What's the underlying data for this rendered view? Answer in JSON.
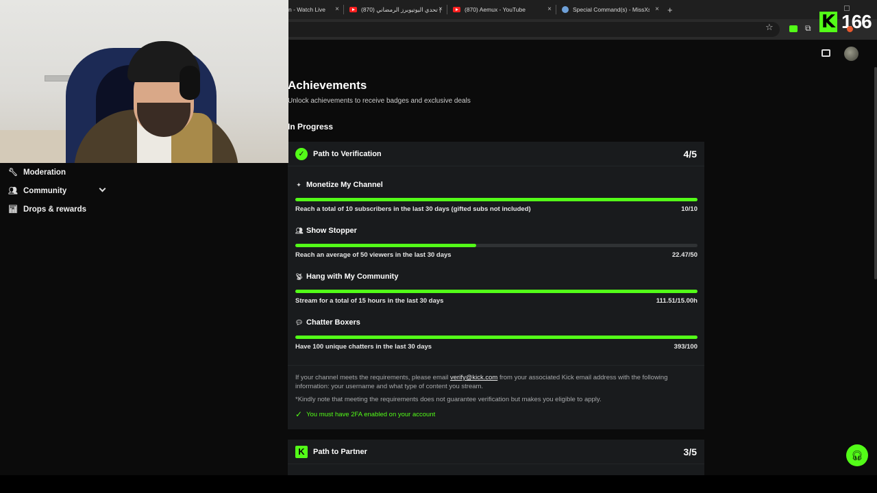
{
  "browser": {
    "tabs": [
      {
        "title": "n - Watch Live",
        "icon": "none"
      },
      {
        "title": "(870) تحدي اليوتيوبرز الرمضاني |",
        "icon": "youtube-icon"
      },
      {
        "title": "(870) Aemux - YouTube",
        "icon": "youtube-icon"
      },
      {
        "title": "Special Command(s) - MissXss",
        "icon": "globe-icon"
      }
    ],
    "close_glyph": "×",
    "new_tab_glyph": "+"
  },
  "kick_counter": {
    "logo": "K",
    "value": "166"
  },
  "sidebar": {
    "items": [
      {
        "label": "Moderation",
        "icon": "wrench-icon"
      },
      {
        "label": "Community",
        "icon": "users-icon"
      },
      {
        "label": "Drops & rewards",
        "icon": "gift-chart-icon"
      }
    ]
  },
  "main": {
    "title": "Achievements",
    "subtitle": "Unlock achievements to receive badges and exclusive deals",
    "section_title": "In Progress",
    "verification": {
      "title": "Path to Verification",
      "score": "4/5",
      "tasks": [
        {
          "title": "Monetize My Channel",
          "icon": "sparkle-icon",
          "desc": "Reach a total of 10 subscribers in the last 30 days (gifted subs not included)",
          "value": "10/10",
          "progress": 1.0
        },
        {
          "title": "Show Stopper",
          "icon": "users-icon",
          "desc": "Reach an average of 50 viewers in the last 30 days",
          "value": "22.47/50",
          "progress": 0.449
        },
        {
          "title": "Hang with My Community",
          "icon": "broadcast-icon",
          "desc": "Stream for a total of 15 hours in the last 30 days",
          "value": "111.51/15.00h",
          "progress": 1.0
        },
        {
          "title": "Chatter Boxers",
          "icon": "chat-icon",
          "desc": "Have 100 unique chatters in the last 30 days",
          "value": "393/100",
          "progress": 1.0
        }
      ],
      "note_prefix": "If your channel meets the requirements, please email ",
      "note_email": "verify@kick.com",
      "note_suffix": " from your associated Kick email address with the following information: your username and what type of content you stream.",
      "disclaimer": "*Kindly note that meeting the requirements does not guarantee verification but makes you eligible to apply.",
      "requirement": "You must have 2FA enabled on your account"
    },
    "partner": {
      "title": "Path to Partner",
      "score": "3/5"
    }
  },
  "colors": {
    "accent": "#53fc18",
    "card": "#191b1d",
    "page": "#0b0b0b"
  }
}
